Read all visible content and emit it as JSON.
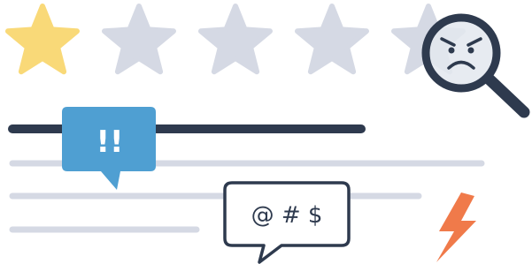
{
  "rating": {
    "value": 1,
    "max": 5
  },
  "callouts": {
    "alert_text": "!!",
    "symbols_text": "@ # $"
  },
  "icons": {
    "stars": "star-icon",
    "magnifier": "magnifying-glass-icon",
    "face": "angry-face-icon",
    "lightning": "lightning-bolt-icon"
  },
  "colors": {
    "star_filled": "#f9d978",
    "star_empty": "#d5d9e4",
    "dark": "#2e3a4e",
    "line_light": "#d5d9e4",
    "alert_blue": "#4f9fd2",
    "bolt": "#f07a4a",
    "lens_fill": "#e3e7ef"
  }
}
